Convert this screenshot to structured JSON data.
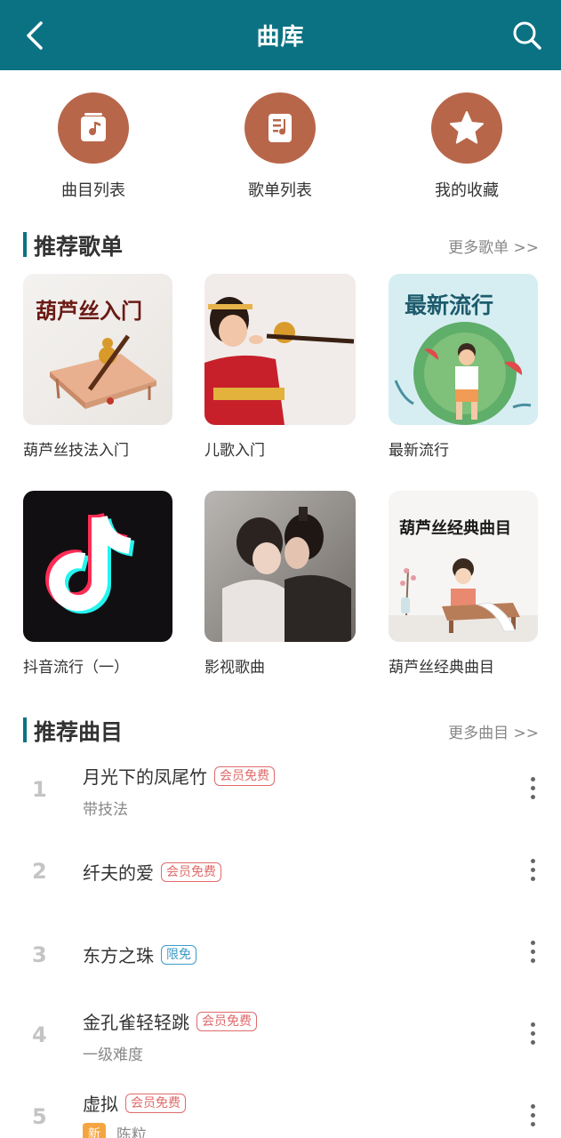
{
  "header": {
    "title": "曲库"
  },
  "quick_actions": [
    {
      "label": "曲目列表",
      "icon": "music-file-icon"
    },
    {
      "label": "歌单列表",
      "icon": "playlist-icon"
    },
    {
      "label": "我的收藏",
      "icon": "star-icon"
    }
  ],
  "playlists_section": {
    "title": "推荐歌单",
    "more": "更多歌单 >>"
  },
  "playlists": [
    {
      "name": "葫芦丝技法入门",
      "cover_text": "葫芦丝入门"
    },
    {
      "name": "儿歌入门"
    },
    {
      "name": "最新流行",
      "cover_text": "最新流行"
    },
    {
      "name": "抖音流行（一）"
    },
    {
      "name": "影视歌曲"
    },
    {
      "name": "葫芦丝经典曲目",
      "cover_text": "葫芦丝经典曲目"
    }
  ],
  "tracks_section": {
    "title": "推荐曲目",
    "more": "更多曲目 >>"
  },
  "tracks": [
    {
      "num": "1",
      "title": "月光下的凤尾竹",
      "tag": "会员免费",
      "sub": "带技法"
    },
    {
      "num": "2",
      "title": "纤夫的爱",
      "tag": "会员免费"
    },
    {
      "num": "3",
      "title": "东方之珠",
      "tag": "限免"
    },
    {
      "num": "4",
      "title": "金孔雀轻轻跳",
      "tag": "会员免费",
      "sub": "一级难度"
    },
    {
      "num": "5",
      "title": "虚拟",
      "tag": "会员免费",
      "badge": "新",
      "sub": "陈粒"
    }
  ],
  "colors": {
    "header": "#0b7283",
    "icon_circle": "#b8664a",
    "vip_tag": "#e06a6a",
    "limited_tag": "#3b9bc8",
    "new_badge": "#f5a540"
  }
}
